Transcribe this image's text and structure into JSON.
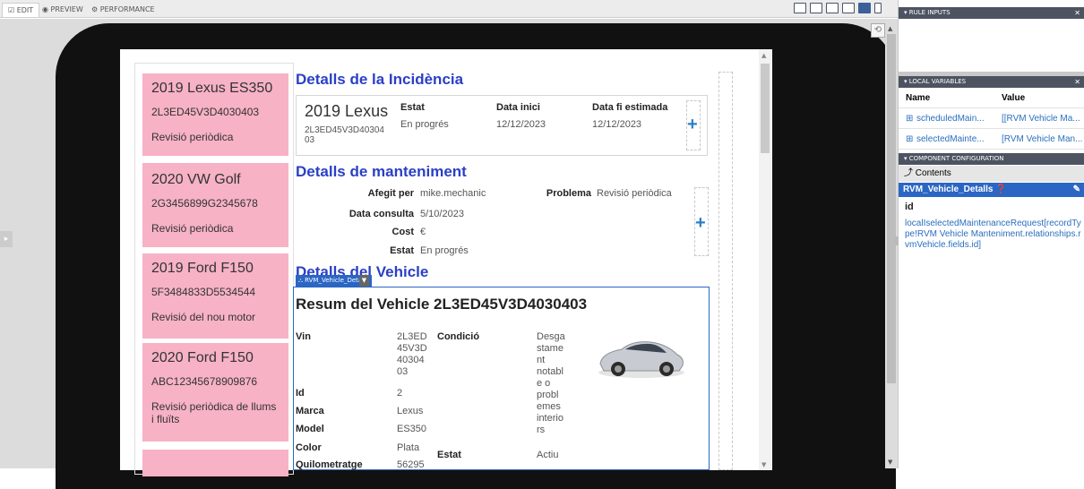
{
  "toolbar": {
    "tabs": [
      {
        "label": "EDIT",
        "icon": "edit-icon"
      },
      {
        "label": "PREVIEW",
        "icon": "eye-icon"
      },
      {
        "label": "PERFORMANCE",
        "icon": "gauge-icon"
      }
    ]
  },
  "records": [
    {
      "title": "2019 Lexus ES350",
      "vin": "2L3ED45V3D4030403",
      "reason": "Revisió periòdica"
    },
    {
      "title": "2020 VW Golf",
      "vin": "2G3456899G2345678",
      "reason": "Revisió periòdica"
    },
    {
      "title": "2019 Ford F150",
      "vin": "5F3484833D5534544",
      "reason": "Revisió del nou motor"
    },
    {
      "title": "2020 Ford F150",
      "vin": "ABC12345678909876",
      "reason": "Revisió periòdica de llums i fluïts"
    }
  ],
  "incidencia": {
    "heading": "Detalls de la Incidència",
    "vehicle": "2019 Lexus",
    "vin": "2L3ED45V3D40304 03",
    "cols": [
      {
        "label": "Estat",
        "value": "En progrés"
      },
      {
        "label": "Data inici",
        "value": "12/12/2023"
      },
      {
        "label": "Data fi estimada",
        "value": "12/12/2023"
      }
    ]
  },
  "manteniment": {
    "heading": "Detalls de manteniment",
    "added_by_label": "Afegit per",
    "added_by": "mike.mechanic",
    "problem_label": "Problema",
    "problem": "Revisió periòdica",
    "date_label": "Data consulta",
    "date": "5/10/2023",
    "cost_label": "Cost",
    "cost": "€",
    "status_label": "Estat",
    "status": "En progrés"
  },
  "vehicle": {
    "heading": "Detalls del Vehicle",
    "component_badge": "RVM_Vehicle_Detalls",
    "summary_title": "Resum del Vehicle 2L3ED45V3D4030403",
    "vin_label": "Vin",
    "vin_value": "2L3ED 45V3D 40304 03",
    "condicio_label": "Condició",
    "condicio_value": "Desga stame nt notabl e o probl emes interio rs",
    "id_label": "Id",
    "id_value": "2",
    "marca_label": "Marca",
    "marca_value": "Lexus",
    "model_label": "Model",
    "model_value": "ES350",
    "color_label": "Color",
    "color_value": "Plata",
    "estat_label": "Estat",
    "estat_value": "Actiu",
    "quilometratge_label": "Quilometratge",
    "quilometratge_value": "56295"
  },
  "right_panel": {
    "rule_inputs": "RULE INPUTS",
    "local_variables": "LOCAL VARIABLES",
    "col_name": "Name",
    "col_value": "Value",
    "variables": [
      {
        "name": "scheduledMain...",
        "value": "[[RVM Vehicle Ma..."
      },
      {
        "name": "selectedMainte...",
        "value": "[RVM Vehicle Man..."
      }
    ],
    "component_configuration": "COMPONENT CONFIGURATION",
    "contents": "Contents",
    "selected": "RVM_Vehicle_Detalls",
    "id_label": "id",
    "id_expression": "localIselectedMaintenanceRequest[recordType!RVM Vehicle Manteniment.relationships.rvmVehicle.fields.id]"
  }
}
